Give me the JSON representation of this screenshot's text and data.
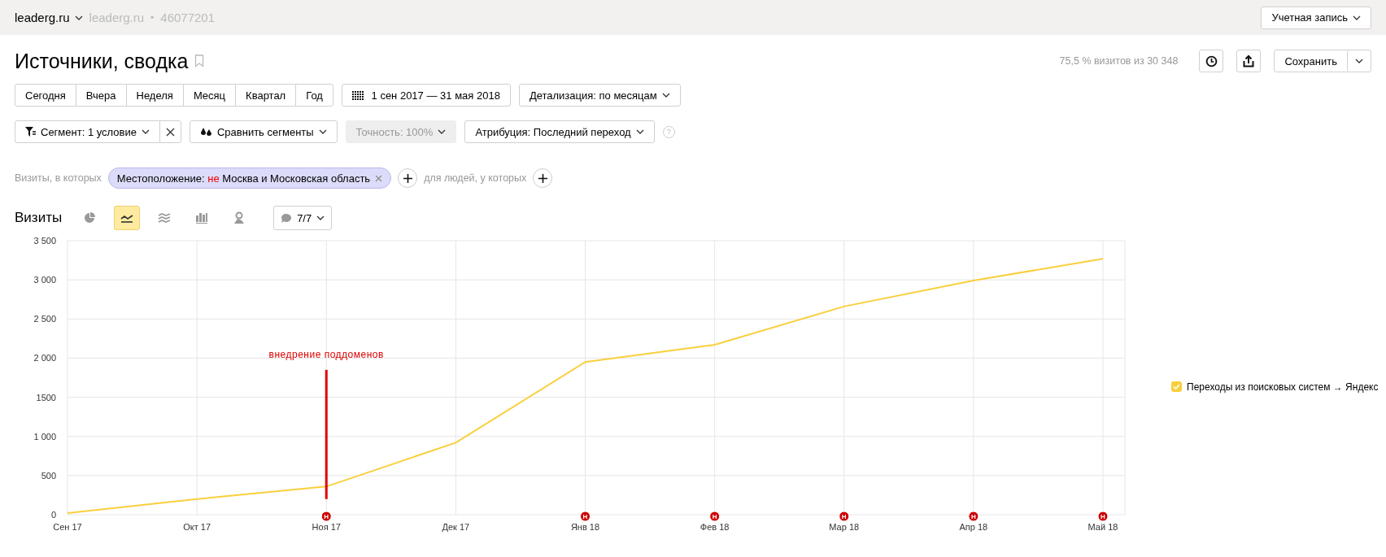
{
  "topbar": {
    "site": "leaderg.ru",
    "counter_name": "leaderg.ru",
    "separator": "•",
    "counter_id": "46077201",
    "account_button": "Учетная запись"
  },
  "title": "Источники, сводка",
  "summary": "75,5 % визитов из 30 348",
  "save_button": "Сохранить",
  "periods": [
    {
      "label": "Сегодня",
      "selected": false
    },
    {
      "label": "Вчера",
      "selected": false
    },
    {
      "label": "Неделя",
      "selected": false
    },
    {
      "label": "Месяц",
      "selected": false
    },
    {
      "label": "Квартал",
      "selected": false
    },
    {
      "label": "Год",
      "selected": false
    }
  ],
  "date_range": "1 сен 2017 — 31 мая 2018",
  "detail": "Детализация: по месяцам",
  "segment": "Сегмент: 1 условие",
  "compare": "Сравнить сегменты",
  "accuracy": {
    "label": "Точность: 100%",
    "disabled": true
  },
  "attribution": "Атрибуция: Последний переход",
  "help": "?",
  "filter": {
    "visits_label": "Визиты, в которых",
    "condition_key": "Местоположение:",
    "condition_negation": "не",
    "condition_value": "Москва и Московская область",
    "people_label": "для людей, у которых"
  },
  "chart_header": {
    "title": "Визиты",
    "notes": "7/7"
  },
  "chart_types": [
    {
      "kind": "pie",
      "selected": false
    },
    {
      "kind": "line",
      "selected": true
    },
    {
      "kind": "area",
      "selected": false
    },
    {
      "kind": "bar",
      "selected": false
    },
    {
      "kind": "map",
      "selected": false
    }
  ],
  "chart_data": {
    "type": "line",
    "categories": [
      "Сен 17",
      "Окт 17",
      "Ноя 17",
      "Дек 17",
      "Янв 18",
      "Фев 18",
      "Мар 18",
      "Апр 18",
      "Май 18"
    ],
    "series": [
      {
        "name": "Переходы из поисковых систем → Яндекс",
        "color": "#f9cf3d",
        "values": [
          20,
          200,
          360,
          920,
          1950,
          2170,
          2660,
          2990,
          3270
        ]
      }
    ],
    "ylim": [
      0,
      3500
    ],
    "yticks": [
      {
        "value": 0,
        "label": "0"
      },
      {
        "value": 500,
        "label": "500"
      },
      {
        "value": 1000,
        "label": "1 000"
      },
      {
        "value": 1500,
        "label": "1500"
      },
      {
        "value": 2000,
        "label": "2 000"
      },
      {
        "value": 2500,
        "label": "2 500"
      },
      {
        "value": 3000,
        "label": "3 000"
      },
      {
        "value": 3500,
        "label": "3 500"
      }
    ],
    "grid": true,
    "annotations": [
      "внедрение поддоменов",
      {
        "x": "Ноя 17",
        "y": 0,
        "text": "Н"
      },
      {
        "x": "Янв 18",
        "y": 0,
        "text": "Н"
      },
      {
        "x": "Фев 18",
        "y": 0,
        "text": "Н"
      },
      {
        "x": "Мар 18",
        "y": 0,
        "text": "Н"
      },
      {
        "x": "Апр 18",
        "y": 0,
        "text": "Н"
      },
      {
        "x": "Май 18",
        "y": 0,
        "text": "Н"
      }
    ]
  },
  "legend": [
    {
      "checked": true
    }
  ]
}
